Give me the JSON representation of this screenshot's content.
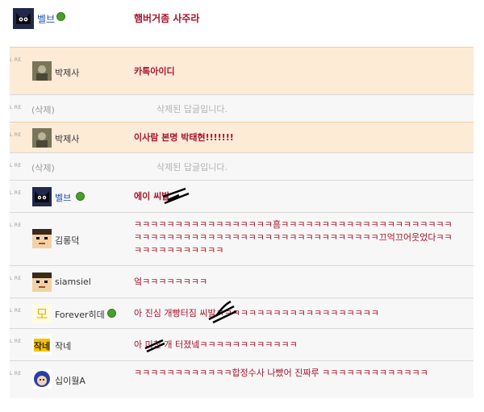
{
  "post": {
    "nickname": "벨브",
    "text": "햄버거좀 사주라",
    "avatar_icon": "black-cat-icon",
    "badge_icon": "green-level-badge-icon"
  },
  "reply_marker": "L RE",
  "comments": [
    {
      "nickname": "박제사",
      "text": "카톡아이디",
      "avatar_icon": "photo-avatar-icon",
      "highlight": true
    },
    {
      "nickname": "(삭제)",
      "text": "삭제된 답글입니다.",
      "deleted": true
    },
    {
      "nickname": "박제사",
      "text": "이사람 본명 박태현!!!!!!!",
      "avatar_icon": "photo-avatar-icon",
      "highlight": true
    },
    {
      "nickname": "(삭제)",
      "text": "삭제된 답글입니다.",
      "deleted": true
    },
    {
      "nickname": "벨브",
      "text": "에이 씨발",
      "avatar_icon": "black-cat-icon",
      "badge_icon": "green-level-badge-icon"
    },
    {
      "nickname": "김롱덕",
      "text": "ㅋㅋㅋㅋㅋㅋㅋㅋㅋㅋㅋㅋㅋㅋㅋㅋㅋ흠ㅋㅋㅋㅋㅋㅋㅋㅋㅋㅋㅋㅋㅋㅋㅋㅋㅋㅋㅋㅋㅋㅋㅋㅋㅋㅋㅋㅋㅋㅋㅋㅋㅋㅋㅋㅋㅋㅋㅋㅋㅋㅋㅋㅋㅋㅋㅋㅋㅋㅋㅋ끄억끄어웃었다ㅋㅋㅋㅋㅋㅋㅋㅋㅋㅋㅋㅋㅋ",
      "avatar_icon": "pixel-face-avatar-icon"
    },
    {
      "nickname": "siamsiel",
      "text": "엌ㅋㅋㅋㅋㅋㅋㅋㅋ",
      "avatar_icon": "pixel-face-avatar-icon"
    },
    {
      "nickname": "Forever히데",
      "text": "아 진심 개빵터짐 씨발ㅋㅋㅋㅋㅋㅋㅋㅋㅋㅋㅋㅋㅋㅋㅋㅋㅋㅋㅋㅋ",
      "avatar_icon": "mo-character-icon",
      "badge_icon": "green-level-badge-icon"
    },
    {
      "nickname": "작네",
      "text": "아 미친 개 터졌넼ㅋㅋㅋㅋㅋㅋㅋㅋㅋㅋㅋㅋ",
      "avatar_icon": "jakne-text-icon"
    },
    {
      "nickname": "십이월A",
      "text": "ㅋㅋㅋㅋㅋㅋㅋㅋㅋㅋㅋㅋ합정수사 나빴어 진짜루 ㅋㅋㅋㅋㅋㅋㅋㅋㅋㅋㅋㅋㅋ",
      "avatar_icon": "blue-helmet-character-icon"
    }
  ]
}
